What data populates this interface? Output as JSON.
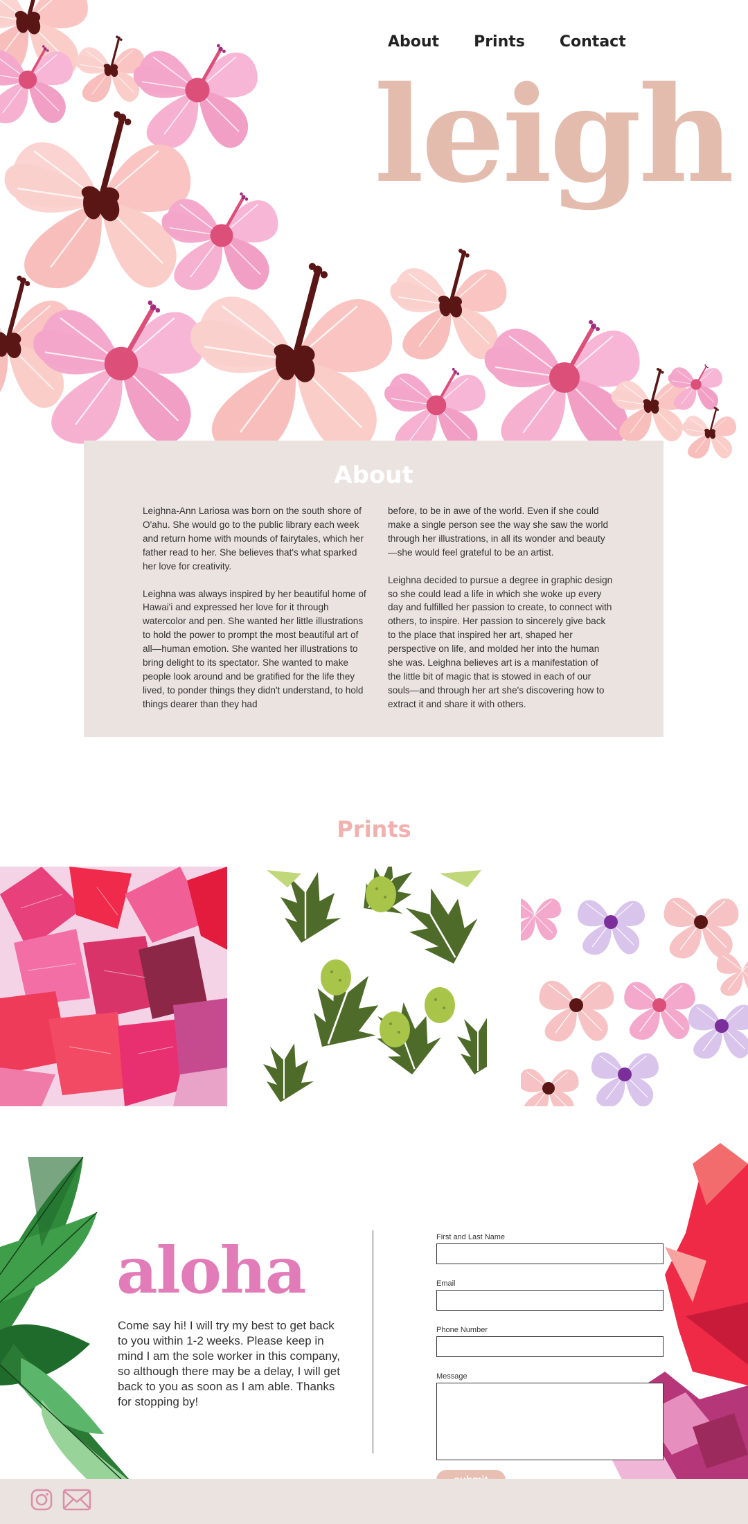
{
  "nav": {
    "about": "About",
    "prints": "Prints",
    "contact": "Contact"
  },
  "brand": {
    "logo": "leigh"
  },
  "about": {
    "title": "About",
    "paragraphs": [
      "Leighna-Ann Lariosa was born on the south shore of O'ahu. She would go to the public library each week and return home with mounds of fairytales, which her father read to her.  She believes that's what sparked her love for creativity.",
      "Leighna was always inspired by her beautiful home of Hawai'i and expressed her love for it through watercolor and pen. She wanted her little illustrations to hold the power to prompt the most beautiful art of all—human emotion. She wanted her illustrations to bring delight to its spectator. She wanted to make people look around and be gratified for the life they lived, to ponder things they didn't understand, to hold things dearer than they had",
      "before, to be in awe of the world. Even if she could make a single person see the way she saw the world through her illustrations, in all its wonder and beauty—she would feel grateful to be an artist.",
      "Leighna decided to pursue a degree in graphic design so she could lead a life in which she woke up every day and fulfilled her passion to create, to connect with others, to inspire. Her passion to sincerely give back to the place that inspired her art, shaped her perspective on life, and molded her into the human she was. Leighna believes art is a manifestation of the little bit of magic that is stowed in each of our souls—and through her art she's discovering how to extract it and share it with others."
    ]
  },
  "prints": {
    "title": "Prints",
    "items": [
      "red-ginger-print",
      "breadfruit-print",
      "hibiscus-print"
    ]
  },
  "contact": {
    "headline": "aloha",
    "message": "Come say hi! I will try my best to get back to you within 1-2 weeks. Please keep in mind I am the sole worker in this company, so although there may be a delay, I will get back to you as soon as I am able. Thanks for stopping by!",
    "fields": {
      "name_label": "First and Last Name",
      "email_label": "Email",
      "phone_label": "Phone Number",
      "message_label": "Message"
    },
    "submit_label": "submit"
  },
  "footer": {
    "icons": [
      "instagram-icon",
      "mail-icon"
    ]
  },
  "colors": {
    "logo": "#e3bcae",
    "about_bg": "#ebe3e0",
    "prints_title": "#f1b1ae",
    "aloha": "#e27cb8",
    "submit": "#e7c0b3"
  }
}
